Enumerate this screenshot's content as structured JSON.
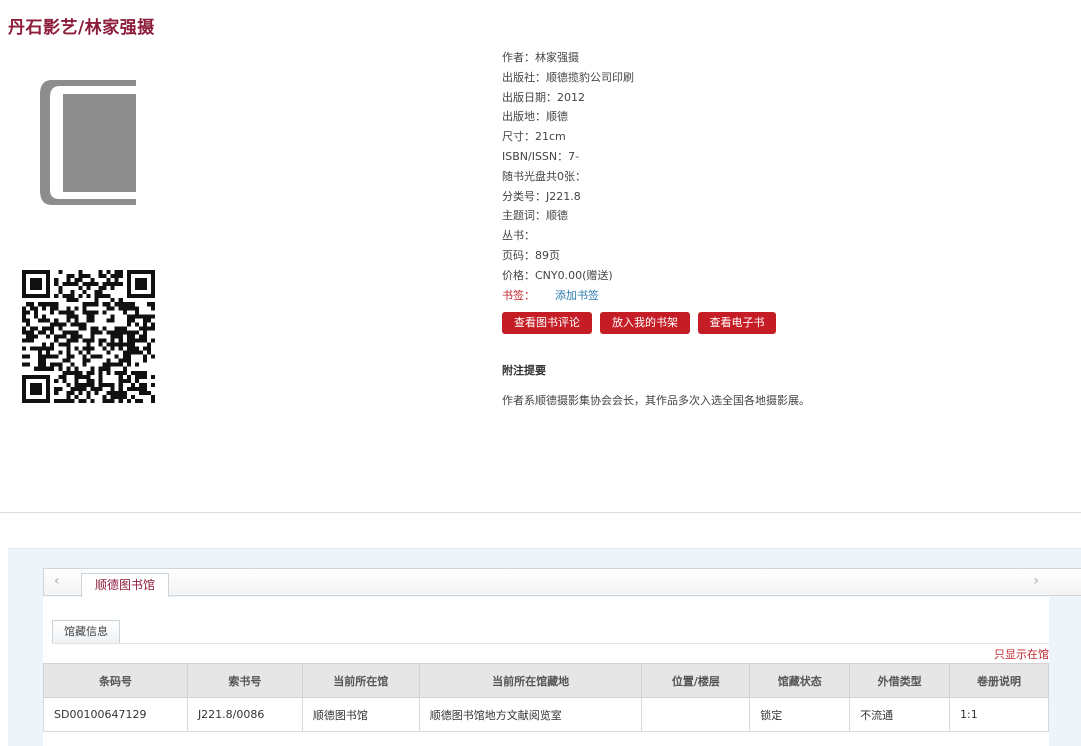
{
  "header": {
    "series": "丹石影艺",
    "separator": "/",
    "author_title": "林家强摄"
  },
  "book_icon": "book-icon",
  "qr_icon": "qr-code-icon",
  "meta": [
    "作者：林家强摄",
    "出版社：顺德揽豹公司印刷",
    "出版日期：2012",
    "出版地：顺德",
    "尺寸：21cm",
    "ISBN/ISSN：7-",
    "随书光盘共0张：",
    "分类号：J221.8",
    "主题词：顺德",
    "丛书：",
    "页码：89页",
    "价格：CNY0.00(赠送)"
  ],
  "bookmark": {
    "label": "书签：",
    "link": "添加书签"
  },
  "buttons": {
    "review": "查看图书评论",
    "shelf": "放入我的书架",
    "ebook": "查看电子书"
  },
  "abstract": {
    "title": "附注提要",
    "text": "作者系顺德摄影集协会会长，其作品多次入选全国各地摄影展。"
  },
  "tabs": {
    "library": "顺德图书馆",
    "holdings": "馆藏信息",
    "only_in_library": "只显示在馆"
  },
  "table": {
    "headers": [
      "条码号",
      "索书号",
      "当前所在馆",
      "当前所在馆藏地",
      "位置/楼层",
      "馆藏状态",
      "外借类型",
      "卷册说明"
    ],
    "rows": [
      [
        "SD00100647129",
        "J221.8/0086",
        "顺德图书馆",
        "顺德图书馆地方文献阅览室",
        "",
        "锁定",
        "不流通",
        "1:1"
      ]
    ]
  },
  "colors": {
    "accent": "#8c1c3a",
    "button": "#c51d25",
    "link": "#2a7ab0"
  }
}
